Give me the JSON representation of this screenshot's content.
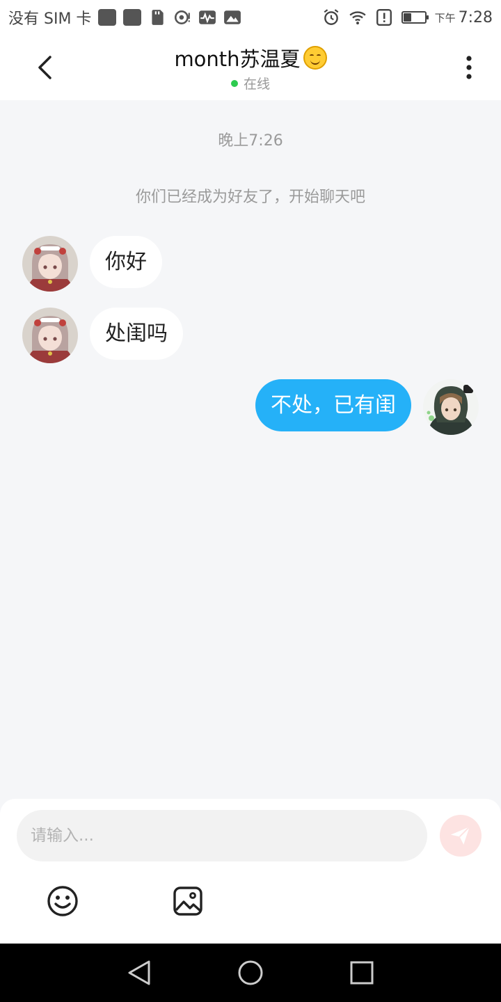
{
  "status_bar": {
    "carrier": "没有 SIM 卡",
    "time_prefix": "下午",
    "time": "7:28",
    "battery_level": 0.35
  },
  "header": {
    "contact_name": "month苏温夏",
    "status": "在线",
    "status_color": "#2dcb4f"
  },
  "chat": {
    "time_label": "晚上7:26",
    "system_message": "你们已经成为好友了，开始聊天吧",
    "messages": [
      {
        "direction": "in",
        "text": "你好"
      },
      {
        "direction": "in",
        "text": "处闺吗"
      },
      {
        "direction": "out",
        "text": "不处，已有闺"
      }
    ]
  },
  "composer": {
    "placeholder": "请输入...",
    "value": "",
    "send_icon": "paper-plane-icon",
    "tools": [
      "emoji-icon",
      "image-icon"
    ]
  },
  "colors": {
    "accent": "#25b1f8",
    "background": "#f5f6f8",
    "send_button": "#fde3e2"
  }
}
